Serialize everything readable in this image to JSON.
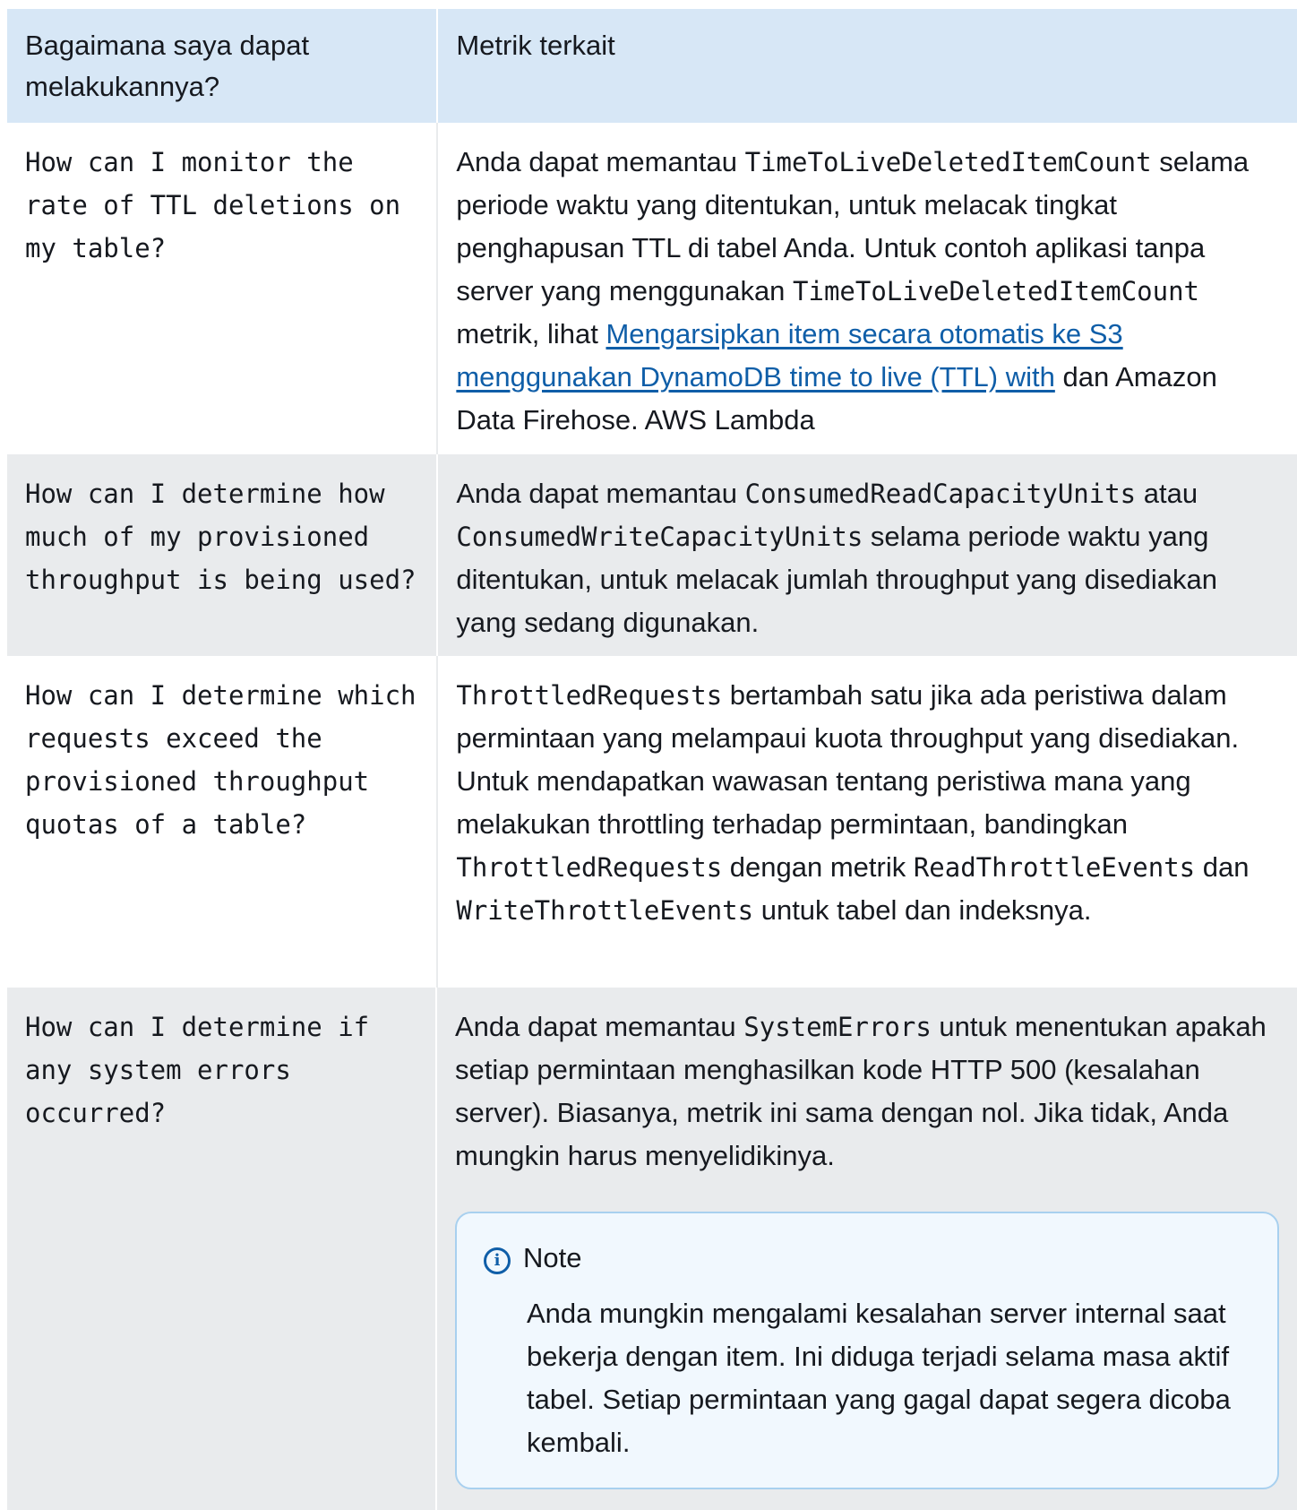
{
  "table": {
    "header": {
      "col1": "Bagaimana saya dapat melakukannya?",
      "col2": "Metrik terkait"
    },
    "rows": [
      {
        "question": "How can I monitor the rate of TTL deletions on my table?",
        "answer": {
          "t1": "Anda dapat memantau ",
          "c1": "TimeToLiveDeletedItemCount",
          "t2": " selama periode waktu yang ditentukan, untuk melacak tingkat penghapusan TTL di tabel Anda. Untuk contoh aplikasi tanpa server yang menggunakan ",
          "c2": "TimeToLiveDeletedItemCount",
          "t3": " metrik, lihat ",
          "link": "Mengarsipkan item secara otomatis ke S3 menggunakan DynamoDB time to live (TTL) with",
          "t4": " dan Amazon Data Firehose. AWS Lambda"
        }
      },
      {
        "question": "How can I determine how much of my provisioned throughput is being used?",
        "answer": {
          "t1": "Anda dapat memantau ",
          "c1": "ConsumedReadCapacityUnits",
          "t2": " atau ",
          "c2": "ConsumedWriteCapacityUnits",
          "t3": " selama periode waktu yang ditentukan, untuk melacak jumlah throughput yang disediakan yang sedang digunakan."
        }
      },
      {
        "question": "How can I determine which requests exceed the provisioned throughput quotas of a table?",
        "answer": {
          "c1": "ThrottledRequests",
          "t1": " bertambah satu jika ada peristiwa dalam permintaan yang melampaui kuota throughput yang disediakan. Untuk mendapatkan wawasan tentang peristiwa mana yang melakukan throttling terhadap permintaan, bandingkan ",
          "c2": "ThrottledRequests",
          "t2": " dengan metrik ",
          "c3": "ReadThrottleEvents",
          "t3": " dan ",
          "c4": "WriteThrottleEvents",
          "t4": " untuk tabel dan indeksnya."
        }
      },
      {
        "question": "How can I determine if any system errors occurred?",
        "answer": {
          "t1": "Anda dapat memantau ",
          "c1": "SystemErrors",
          "t2": " untuk menentukan apakah setiap permintaan menghasilkan kode HTTP 500 (kesalahan server). Biasanya, metrik ini sama dengan nol. Jika tidak, Anda mungkin harus menyelidikinya."
        },
        "note": {
          "title": "Note",
          "body": "Anda mungkin mengalami kesalahan server internal saat bekerja dengan item. Ini diduga terjadi selama masa aktif tabel. Setiap permintaan yang gagal dapat segera dicoba kembali."
        }
      }
    ]
  },
  "colors": {
    "header_bg": "#d7e7f6",
    "row_alt_bg": "#e9ebed",
    "link": "#0f5ea8",
    "note_bg": "#f1f8fe",
    "note_border": "#a8d0ef"
  }
}
